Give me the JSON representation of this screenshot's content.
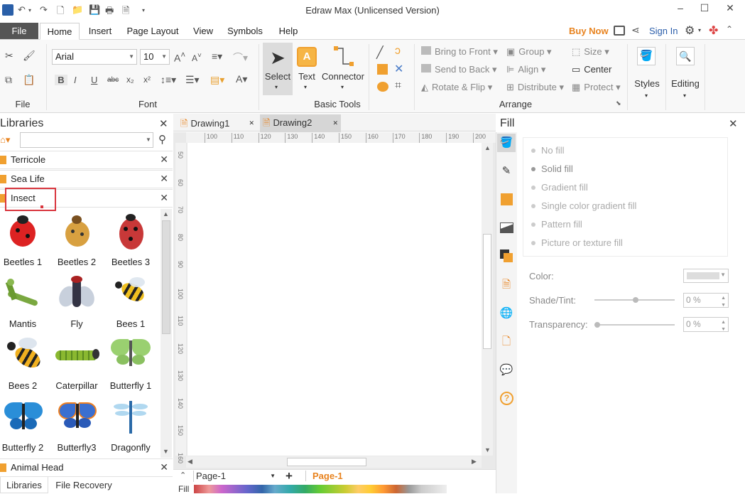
{
  "window": {
    "title": "Edraw Max (Unlicensed Version)"
  },
  "menu": {
    "file": "File",
    "tabs": [
      "Home",
      "Insert",
      "Page Layout",
      "View",
      "Symbols",
      "Help"
    ],
    "buy_now": "Buy Now",
    "sign_in": "Sign In"
  },
  "ribbon": {
    "file_group": {
      "label": "File"
    },
    "font_group": {
      "label": "Font",
      "font_name": "Arial",
      "font_size": "10"
    },
    "basic_tools": {
      "label": "Basic Tools",
      "select": "Select",
      "text": "Text",
      "connector": "Connector"
    },
    "arrange": {
      "label": "Arrange",
      "bring_to_front": "Bring to Front",
      "send_to_back": "Send to Back",
      "rotate_flip": "Rotate & Flip",
      "group": "Group",
      "align": "Align",
      "distribute": "Distribute",
      "size": "Size",
      "center": "Center",
      "protect": "Protect"
    },
    "styles": "Styles",
    "editing": "Editing"
  },
  "libraries": {
    "title": "Libraries",
    "search_placeholder": "",
    "categories": [
      "Terricole",
      "Sea Life",
      "Insect"
    ],
    "shapes": [
      "Beetles 1",
      "Beetles 2",
      "Beetles 3",
      "Mantis",
      "Fly",
      "Bees 1",
      "Bees 2",
      "Caterpillar",
      "Butterfly 1",
      "Butterfly 2",
      "Butterfly3",
      "Dragonfly"
    ],
    "bottom_category": "Animal Head",
    "bottom_tabs": [
      "Libraries",
      "File Recovery"
    ]
  },
  "documents": {
    "tabs": [
      "Drawing1",
      "Drawing2"
    ]
  },
  "ruler": {
    "top": [
      "100",
      "110",
      "120",
      "130",
      "140",
      "150",
      "160",
      "170",
      "180",
      "190",
      "200"
    ],
    "left": [
      "50",
      "60",
      "70",
      "80",
      "90",
      "100",
      "110",
      "120",
      "130",
      "140",
      "150",
      "160"
    ]
  },
  "pages": {
    "current": "Page-1",
    "tab": "Page-1"
  },
  "fill_panel": {
    "title": "Fill",
    "options": [
      "No fill",
      "Solid fill",
      "Gradient fill",
      "Single color gradient fill",
      "Pattern fill",
      "Picture or texture fill"
    ],
    "color_label": "Color:",
    "shade_label": "Shade/Tint:",
    "shade_value": "0 %",
    "transparency_label": "Transparency:",
    "transparency_value": "0 %"
  },
  "status": {
    "fill_label": "Fill"
  },
  "colors": {
    "accent": "#e8831f",
    "file_tab": "#555555",
    "highlight_box": "#d9363e"
  }
}
